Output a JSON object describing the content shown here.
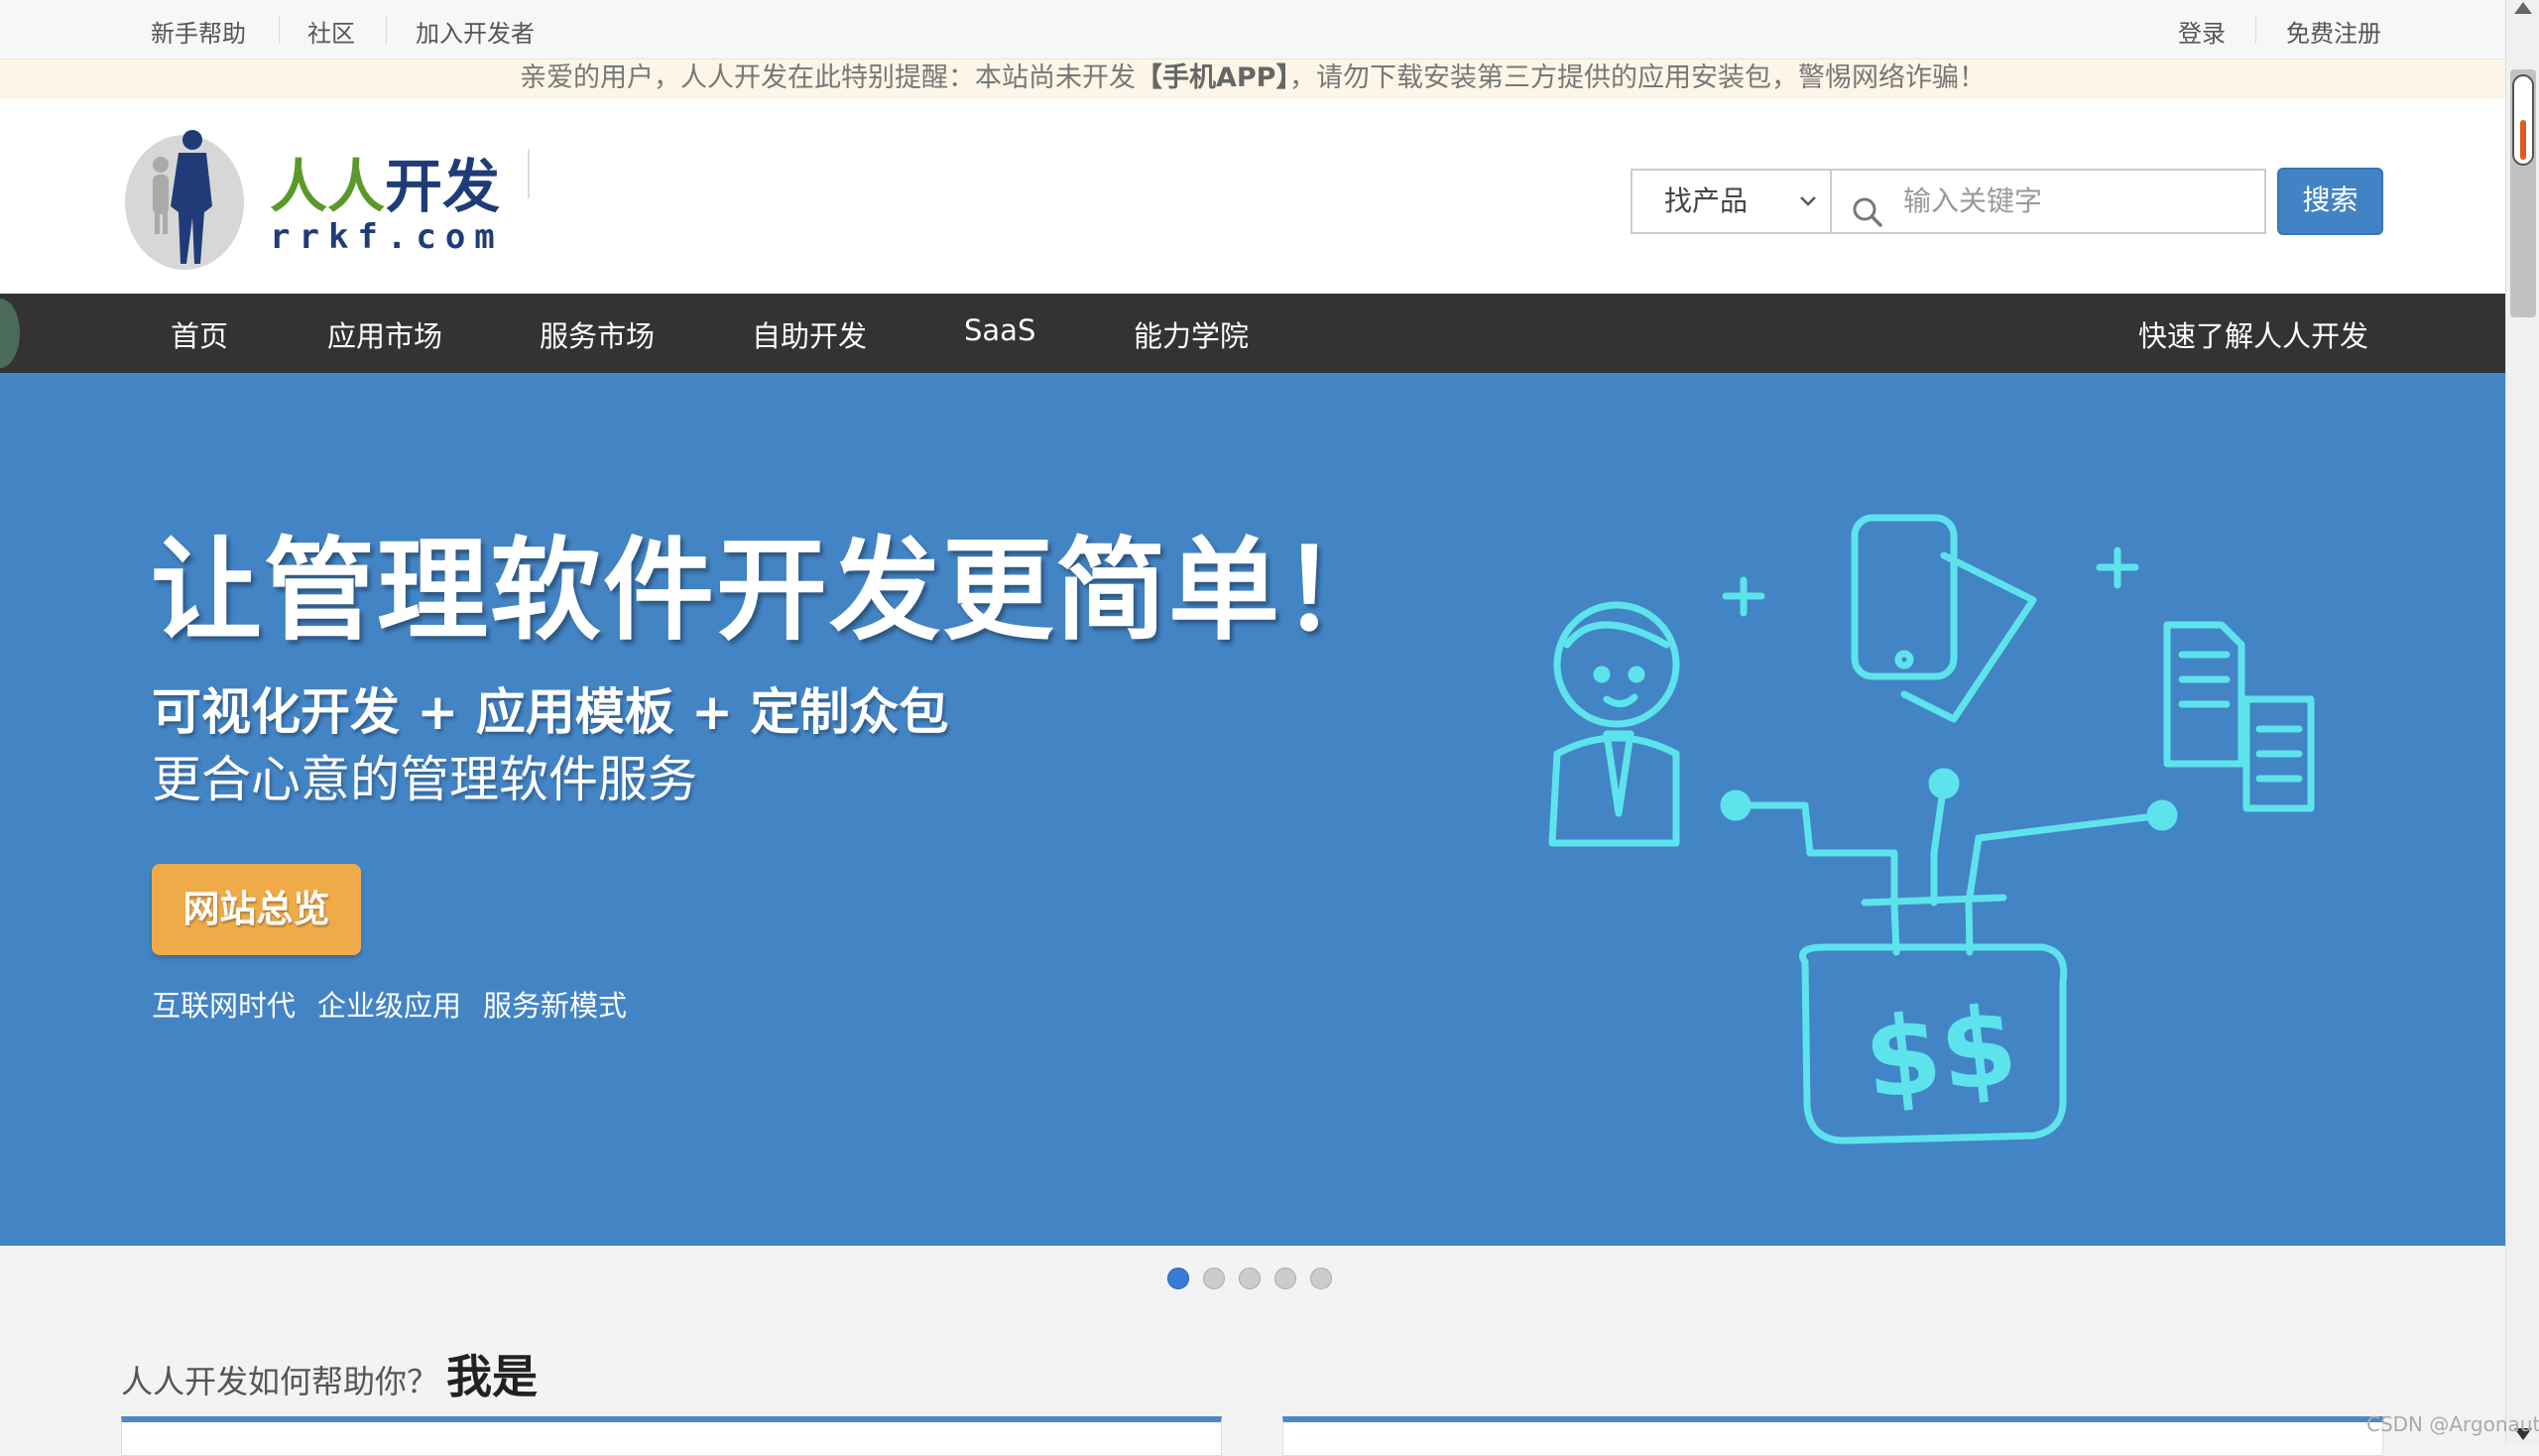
{
  "topbar": {
    "left_links": [
      "新手帮助",
      "社区",
      "加入开发者"
    ],
    "right_links": [
      "登录",
      "免费注册"
    ]
  },
  "notice": {
    "before": "亲爱的用户，人人开发在此特别提醒：本站尚未开发",
    "highlight": "【手机APP】",
    "after": "，请勿下载安装第三方提供的应用安装包，警惕网络诈骗！"
  },
  "logo": {
    "cn": "人人开发",
    "en": "rrkf.com",
    "colors": {
      "green": "#5a9a2a",
      "navy": "#1f3c78"
    }
  },
  "search": {
    "select_value": "找产品",
    "placeholder": "输入关键字",
    "button_label": "搜索",
    "icon": "search-icon"
  },
  "nav": {
    "items": [
      "首页",
      "应用市场",
      "服务市场",
      "自助开发",
      "SaaS",
      "能力学院"
    ],
    "right_item": "快速了解人人开发"
  },
  "hero": {
    "title": "让管理软件开发更简单！",
    "subtitle": "可视化开发 + 应用模板 + 定制众包",
    "subtitle2": "更合心意的管理软件服务",
    "button": "网站总览",
    "tags": [
      "互联网时代",
      "企业级应用",
      "服务新模式"
    ],
    "bg_color": "#4384c5",
    "accent": "#f0ab49",
    "illustration_color": "#5de3ec",
    "illustration_text": "$$"
  },
  "carousel": {
    "count": 5,
    "active": 1
  },
  "help": {
    "question": "人人开发如何帮助你？",
    "answer": "我是"
  },
  "watermark": "CSDN @Argonaut"
}
